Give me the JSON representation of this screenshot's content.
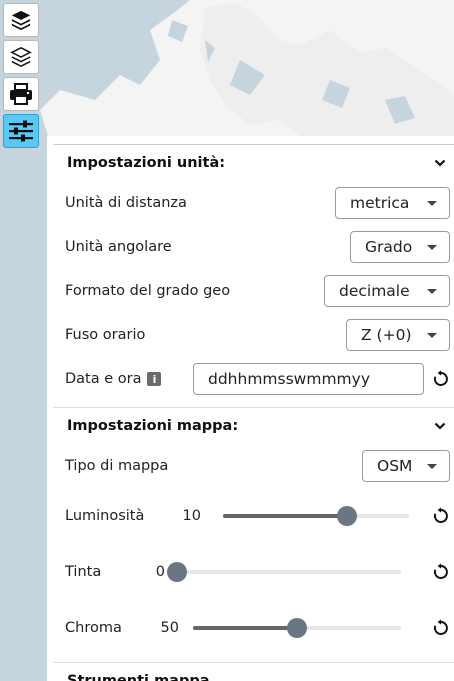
{
  "unit_settings": {
    "title": "Impostazioni unità:",
    "distance": {
      "label": "Unità di distanza",
      "value": "metrica"
    },
    "angular": {
      "label": "Unità angolare",
      "value": "Grado"
    },
    "geo_format": {
      "label": "Formato del grado geo",
      "value": "decimale"
    },
    "timezone": {
      "label": "Fuso orario",
      "value": "Z (+0)"
    },
    "datetime": {
      "label": "Data e ora",
      "value": "ddhhmmsswmmmyy"
    }
  },
  "map_settings": {
    "title": "Impostazioni mappa:",
    "map_type": {
      "label": "Tipo di mappa",
      "value": "OSM"
    },
    "brightness": {
      "label": "Luminosità",
      "value": 10,
      "max": 15
    },
    "hue": {
      "label": "Tinta",
      "value": 0,
      "max": 100
    },
    "chroma": {
      "label": "Chroma",
      "value": 50,
      "max": 100
    }
  },
  "map_tools": {
    "title": "Strumenti mappa"
  },
  "icons": {
    "layers": "layers-icon",
    "layers_outline": "layers-outline-icon",
    "print": "printer-icon",
    "settings": "sliders-icon",
    "info": "info-icon",
    "reset": "reset-icon",
    "chevron": "chevron-down-icon"
  },
  "colors": {
    "active_tool": "#5ac8f5",
    "map_water": "#c6d4dd",
    "map_land": "#f4f4f4"
  }
}
